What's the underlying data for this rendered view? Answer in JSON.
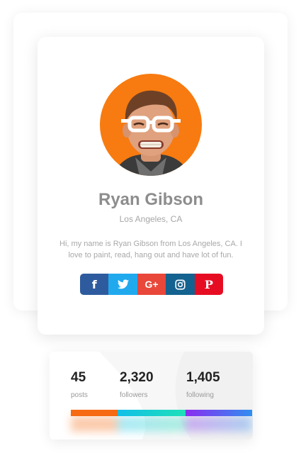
{
  "profile": {
    "name": "Ryan Gibson",
    "location": "Los Angeles, CA",
    "bio": "Hi, my name is Ryan Gibson from Los Angeles, CA. I love to paint, read, hang out and have lot of fun.",
    "avatar_background": "#f77b10"
  },
  "socials": [
    {
      "network": "facebook",
      "icon": "facebook-icon",
      "glyph": "f",
      "color": "#2e5b9e"
    },
    {
      "network": "twitter",
      "icon": "twitter-icon",
      "glyph": "🐦",
      "color": "#21a9ee"
    },
    {
      "network": "google-plus",
      "icon": "google-plus-icon",
      "glyph": "G+",
      "color": "#e8473a"
    },
    {
      "network": "instagram",
      "icon": "instagram-icon",
      "glyph": "◎",
      "color": "#14628f"
    },
    {
      "network": "pinterest",
      "icon": "pinterest-icon",
      "glyph": "P",
      "color": "#e60d23"
    }
  ],
  "stats": [
    {
      "value": "45",
      "label": "posts"
    },
    {
      "value": "2,320",
      "label": "followers"
    },
    {
      "value": "1,405",
      "label": "following"
    }
  ],
  "stat_bar_colors": [
    "#f56a12",
    "#11bfe8",
    "#8b2cf0"
  ]
}
